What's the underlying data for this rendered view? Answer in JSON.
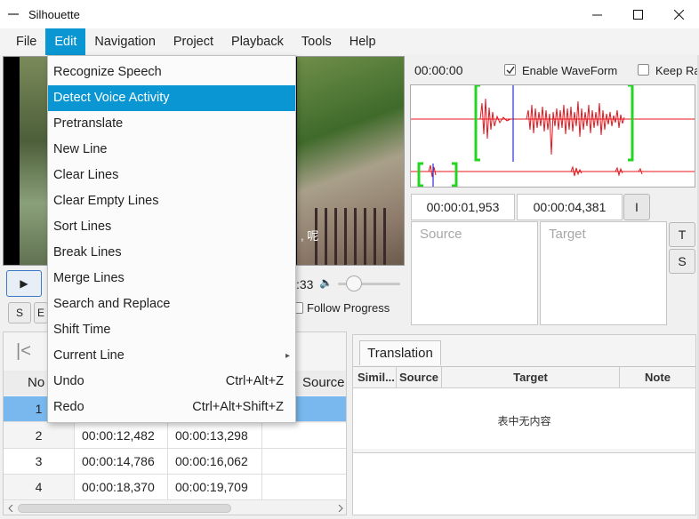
{
  "window": {
    "title": "Silhouette"
  },
  "menubar": {
    "items": [
      "File",
      "Edit",
      "Navigation",
      "Project",
      "Playback",
      "Tools",
      "Help"
    ],
    "active": "Edit"
  },
  "edit_menu": {
    "items": [
      {
        "label": "Recognize Speech",
        "shortcut": ""
      },
      {
        "label": "Detect Voice Activity",
        "shortcut": ""
      },
      {
        "label": "Pretranslate",
        "shortcut": ""
      },
      {
        "label": "New Line",
        "shortcut": ""
      },
      {
        "label": "Clear Lines",
        "shortcut": ""
      },
      {
        "label": "Clear Empty Lines",
        "shortcut": ""
      },
      {
        "label": "Sort Lines",
        "shortcut": ""
      },
      {
        "label": "Break Lines",
        "shortcut": ""
      },
      {
        "label": "Merge Lines",
        "shortcut": ""
      },
      {
        "label": "Search and Replace",
        "shortcut": ""
      },
      {
        "label": "Shift Time",
        "shortcut": ""
      },
      {
        "label": "Current Line",
        "shortcut": "",
        "submenu": true
      },
      {
        "label": "Undo",
        "shortcut": "Ctrl+Alt+Z"
      },
      {
        "label": "Redo",
        "shortcut": "Ctrl+Alt+Shift+Z"
      }
    ],
    "highlighted": "Detect Voice Activity"
  },
  "video": {
    "subtitle_fragment": ", 呢"
  },
  "player": {
    "play_symbol": "▶",
    "time_fragment": ":33",
    "volume_symbol": "🔈",
    "s_button": "S",
    "e_button": "E",
    "follow_progress_label": "Follow Progress",
    "follow_progress_checked": false
  },
  "waveform_panel": {
    "current_time": "00:00:00",
    "enable_waveform_label": "Enable WaveForm",
    "enable_waveform_checked": true,
    "keep_label": "Keep Ra",
    "keep_checked": false,
    "colors": {
      "wave": "#e8141b",
      "selection": "#22d622",
      "cursor": "#2b2bd8"
    }
  },
  "line_editor": {
    "start_time": "00:00:01,953",
    "end_time": "00:00:04,381",
    "ibeam_symbol": "I",
    "source_placeholder": "Source",
    "target_placeholder": "Target",
    "t_button": "T",
    "s_button": "S"
  },
  "lines_table": {
    "headers": {
      "no": "No",
      "source": "Source"
    },
    "rows": [
      {
        "no": "1",
        "start": "",
        "end": "",
        "source": ""
      },
      {
        "no": "2",
        "start": "00:00:12,482",
        "end": "00:00:13,298",
        "source": ""
      },
      {
        "no": "3",
        "start": "00:00:14,786",
        "end": "00:00:16,062",
        "source": ""
      },
      {
        "no": "4",
        "start": "00:00:18,370",
        "end": "00:00:19,709",
        "source": ""
      }
    ],
    "selected_row": 1,
    "first_symbol": "|<"
  },
  "translation": {
    "tab_label": "Translation",
    "headers": [
      "Simil...",
      "Source",
      "Target",
      "Note"
    ],
    "empty_text": "表中无内容"
  }
}
